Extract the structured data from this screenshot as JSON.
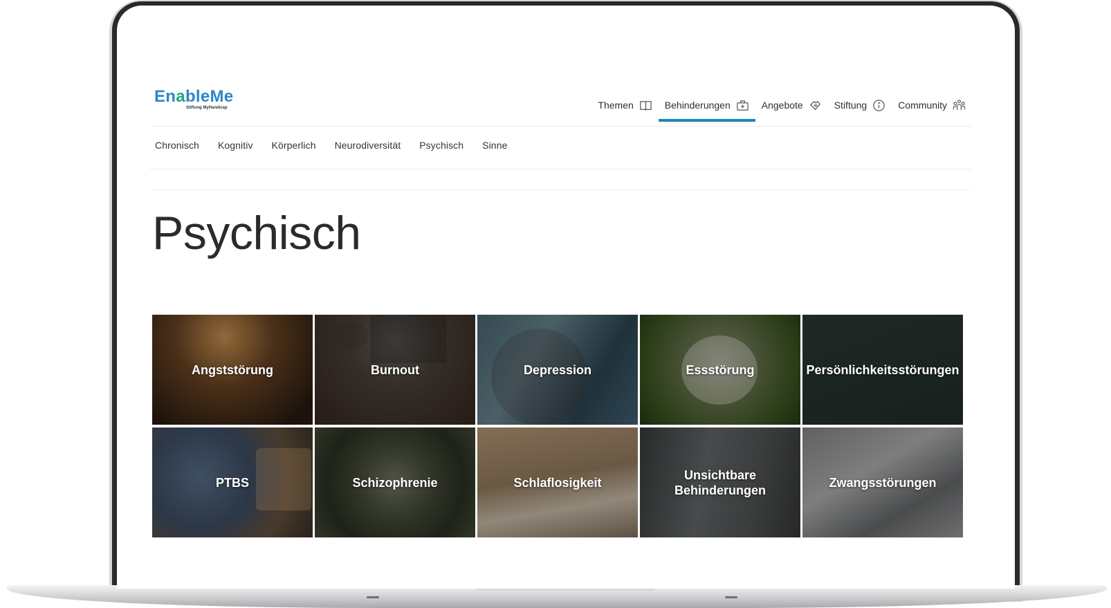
{
  "brand": {
    "name_prefix": "En",
    "name_o": "a",
    "name_suffix": "ble",
    "name_me": "Me",
    "tagline": "Stiftung MyHandicap"
  },
  "topnav": [
    {
      "label": "Themen",
      "icon": "book-icon",
      "active": false
    },
    {
      "label": "Behinderungen",
      "icon": "medical-case-icon",
      "active": true
    },
    {
      "label": "Angebote",
      "icon": "handshake-icon",
      "active": false
    },
    {
      "label": "Stiftung",
      "icon": "info-icon",
      "active": false
    },
    {
      "label": "Community",
      "icon": "people-icon",
      "active": false
    }
  ],
  "subnav": [
    "Chronisch",
    "Kognitiv",
    "Körperlich",
    "Neurodiversität",
    "Psychisch",
    "Sinne"
  ],
  "page_title": "Psychisch",
  "tiles": [
    "Angststörung",
    "Burnout",
    "Depression",
    "Essstörung",
    "Persönlichkeitsstörungen",
    "PTBS",
    "Schizophrenie",
    "Schlaflosigkeit",
    "Unsichtbare Behinderungen",
    "Zwangsstörungen"
  ],
  "colors": {
    "accent": "#1c86b7",
    "logo_blue": "#2c86c7",
    "logo_green": "#1aa97a",
    "text": "#2f2f2f"
  }
}
